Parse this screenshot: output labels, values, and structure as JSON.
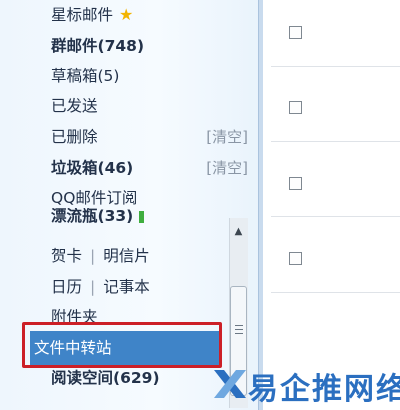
{
  "nav": {
    "starred": "星标邮件",
    "group_mail": "群邮件(748)",
    "drafts": "草稿箱(5)",
    "sent": "已发送",
    "deleted": "已删除",
    "deleted_clear": "[清空]",
    "spam": "垃圾箱(46)",
    "spam_clear": "[清空]",
    "qq_subscription": "QQ邮件订阅",
    "drift_bottle": "漂流瓶(33)",
    "card": "贺卡",
    "postcard": "明信片",
    "separator": "|",
    "calendar": "日历",
    "notepad": "记事本",
    "attachments": "附件夹",
    "file_transfer": "文件中转站",
    "reading_space": "阅读空间(629)"
  },
  "icons": {
    "star": "star-icon",
    "scroll_up": "scroll-up-arrow-icon",
    "scroll_grip": "scroll-grip-icon"
  },
  "watermark": {
    "text": "易企推网络"
  },
  "colors": {
    "accent_selected": "#3f84c8",
    "highlight_frame": "#cc1f27",
    "star": "#f2b400",
    "watermark": "#2b6fc0"
  }
}
